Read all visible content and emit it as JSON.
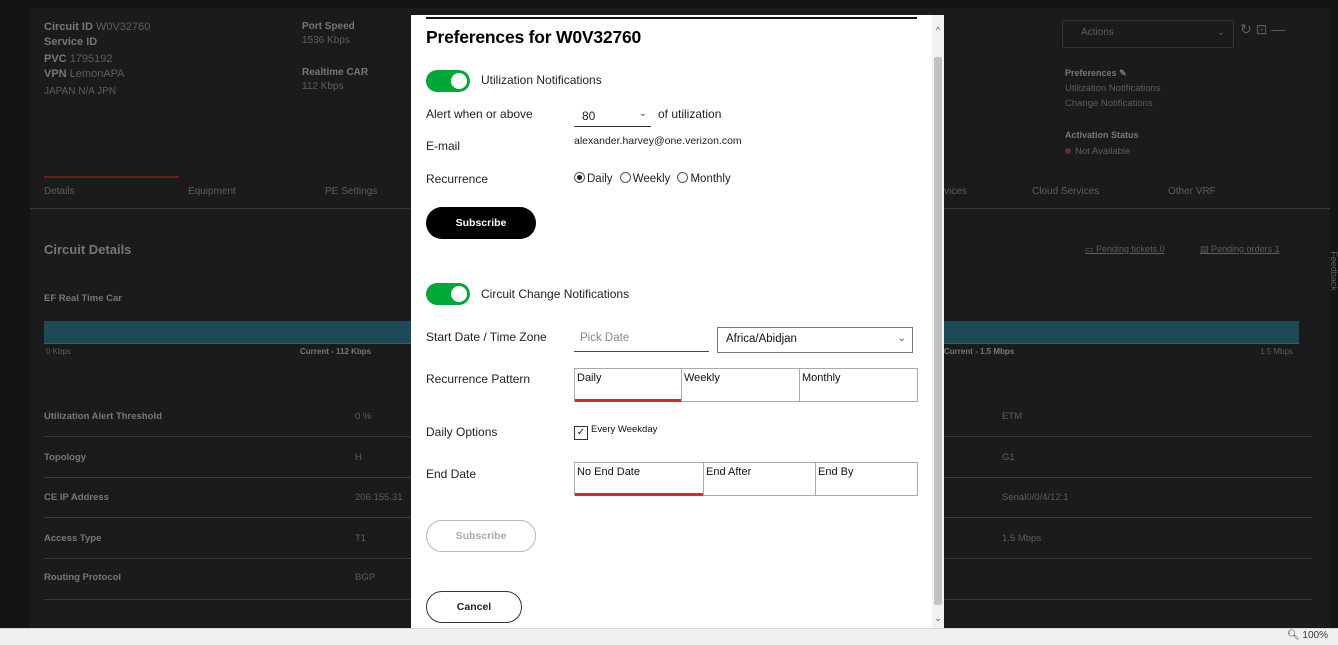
{
  "background": {
    "circuit": {
      "circuit_id_label": "Circuit ID",
      "circuit_id_value": "W0V32760",
      "service_id_label": "Service ID",
      "pvc_label": "PVC",
      "pvc_value": "1795192",
      "vpn_label": "VPN",
      "vpn_value": "LemonAPA",
      "location": "JAPAN N/A JPN"
    },
    "port_speed_label": "Port Speed",
    "port_speed_value": "1536 Kbps",
    "realtime_car_label": "Realtime CAR",
    "realtime_car_value": "112 Kbps",
    "actions_label": "Actions",
    "preferences_label": "Preferences",
    "pref_items": [
      "Utilization Notifications",
      "Change Notifications"
    ],
    "activation_label": "Activation Status",
    "activation_value": "Not Available",
    "tabs": [
      "Details",
      "Equipment",
      "PE Settings",
      "vices",
      "Cloud Services",
      "Other VRF"
    ],
    "circuit_details_title": "Circuit Details",
    "pending_tickets": "Pending tickets 0",
    "pending_orders": "Pending orders 1",
    "ef_title": "EF Real Time Car",
    "bar_left_min": "0 Kbps",
    "bar_left_current": "Current - 112 Kbps",
    "bar_right_current": "Current - 1.5 Mbps",
    "bar_right_max": "1.5 Mbps",
    "rows": [
      {
        "label": "Utilization Alert Threshold",
        "value": "0 %",
        "right": "ETM"
      },
      {
        "label": "Topology",
        "value": "H",
        "right": "G1"
      },
      {
        "label": "CE IP Address",
        "value": "206.155.31",
        "right": "Serial0/0/4/12:1"
      },
      {
        "label": "Access Type",
        "value": "T1",
        "right": "1.5 Mbps"
      },
      {
        "label": "Routing Protocol",
        "value": "BGP",
        "right": ""
      }
    ],
    "feedback": "Feedback"
  },
  "modal": {
    "title": "Preferences for W0V32760",
    "utilization": {
      "toggle_label": "Utilization Notifications",
      "alert_label": "Alert when or above",
      "alert_value": "80",
      "alert_suffix": "of utilization",
      "email_label": "E-mail",
      "email_value": "alexander.harvey@one.verizon.com",
      "recurrence_label": "Recurrence",
      "recurrence_options": [
        "Daily",
        "Weekly",
        "Monthly"
      ],
      "recurrence_selected": "Daily",
      "subscribe_label": "Subscribe"
    },
    "change": {
      "toggle_label": "Circuit Change Notifications",
      "start_label": "Start Date / Time Zone",
      "pick_date_placeholder": "Pick Date",
      "timezone_value": "Africa/Abidjan",
      "pattern_label": "Recurrence Pattern",
      "pattern_options": [
        "Daily",
        "Weekly",
        "Monthly"
      ],
      "pattern_selected": "Daily",
      "daily_options_label": "Daily Options",
      "every_weekday_label": "Every Weekday",
      "end_date_label": "End Date",
      "end_options": [
        "No End Date",
        "End After",
        "End By"
      ],
      "end_selected": "No End Date",
      "subscribe_label": "Subscribe",
      "cancel_label": "Cancel"
    }
  },
  "statusbar": {
    "zoom": "100%"
  },
  "colors": {
    "toggle_on": "#00a838",
    "tab_underline": "#d52b1e",
    "bar_fill": "#1c4a56"
  }
}
